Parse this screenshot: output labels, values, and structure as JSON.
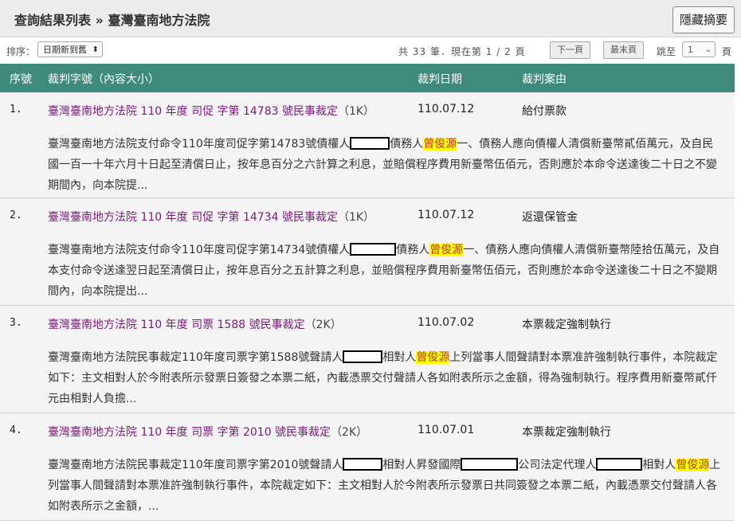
{
  "header": {
    "title": "查詢結果列表 » 臺灣臺南地方法院",
    "hide_summary_button": "隱藏摘要"
  },
  "toolbar": {
    "sort_label": "排序：",
    "sort_value": "日期新到舊",
    "total_prefix": "共",
    "total_count": "33",
    "total_suffix": "筆．現在第",
    "current_page": "1",
    "page_sep": "/",
    "total_pages": "2",
    "page_unit": "頁",
    "next_button": "下一頁",
    "last_button": "最末頁",
    "jump_label": "跳至",
    "jump_value": "1",
    "jump_unit": "頁"
  },
  "columns": {
    "num": "序號",
    "case": "裁判字號（內容大小）",
    "date": "裁判日期",
    "cause": "裁判案由"
  },
  "rows": [
    {
      "num": "1.",
      "title": "臺灣臺南地方法院 110 年度 司促 字第 14783 號民事裁定",
      "size": "（1K）",
      "date": "110.07.12",
      "cause": "給付票款",
      "s1": "臺灣臺南地方法院支付命令110年度司促字第14783號債權人",
      "s2": "債務人",
      "hl": "曾俊源",
      "s3": "一、債務人應向債權人清償新臺幣貳佰萬元，及自民國一百一十年六月十日起至清償日止，按年息百分之六計算之利息，並賠償程序費用新臺幣伍佰元，否則應於本命令送達後二十日之不變期間內，向本院提..."
    },
    {
      "num": "2.",
      "title": "臺灣臺南地方法院 110 年度 司促 字第 14734 號民事裁定",
      "size": "（1K）",
      "date": "110.07.12",
      "cause": "返還保管金",
      "s1": "臺灣臺南地方法院支付命令110年度司促字第14734號債權人",
      "s2": "債務人",
      "hl": "曾俊源",
      "s3": "一、債務人應向債權人清償新臺幣陸拾伍萬元，及自本支付命令送達翌日起至清償日止，按年息百分之五計算之利息，並賠償程序費用新臺幣伍佰元，否則應於本命令送達後二十日之不變期間內，向本院提出..."
    },
    {
      "num": "3.",
      "title": "臺灣臺南地方法院 110 年度 司票 1588 號民事裁定",
      "size": "（2K）",
      "date": "110.07.02",
      "cause": "本票裁定強制執行",
      "s1": "臺灣臺南地方法院民事裁定110年度司票字第1588號聲請人",
      "s2": "相對人",
      "hl": "曾俊源",
      "s3": "上列當事人間聲請對本票准許強制執行事件，本院裁定如下：主文相對人於今附表所示發票日簽發之本票二紙，內載憑票交付聲請人各如附表所示之金額，得為強制執行。程序費用新臺幣貳仟元由相對人負擔..."
    },
    {
      "num": "4.",
      "title": "臺灣臺南地方法院 110 年度 司票 字第 2010 號民事裁定",
      "size": "（2K）",
      "date": "110.07.01",
      "cause": "本票裁定強制執行",
      "s1": "臺灣臺南地方法院民事裁定110年度司票字第2010號聲請人",
      "s2": "相對人昇發國際",
      "s2b": "公司法定代理人",
      "s2c": "相對人",
      "hl": "曾俊源",
      "s3": "上列當事人間聲請對本票准許強制執行事件，本院裁定如下：主文相對人於今附表所示發票日共同簽發之本票二紙，內載憑票交付聲請人各如附表所示之金額，..."
    }
  ]
}
